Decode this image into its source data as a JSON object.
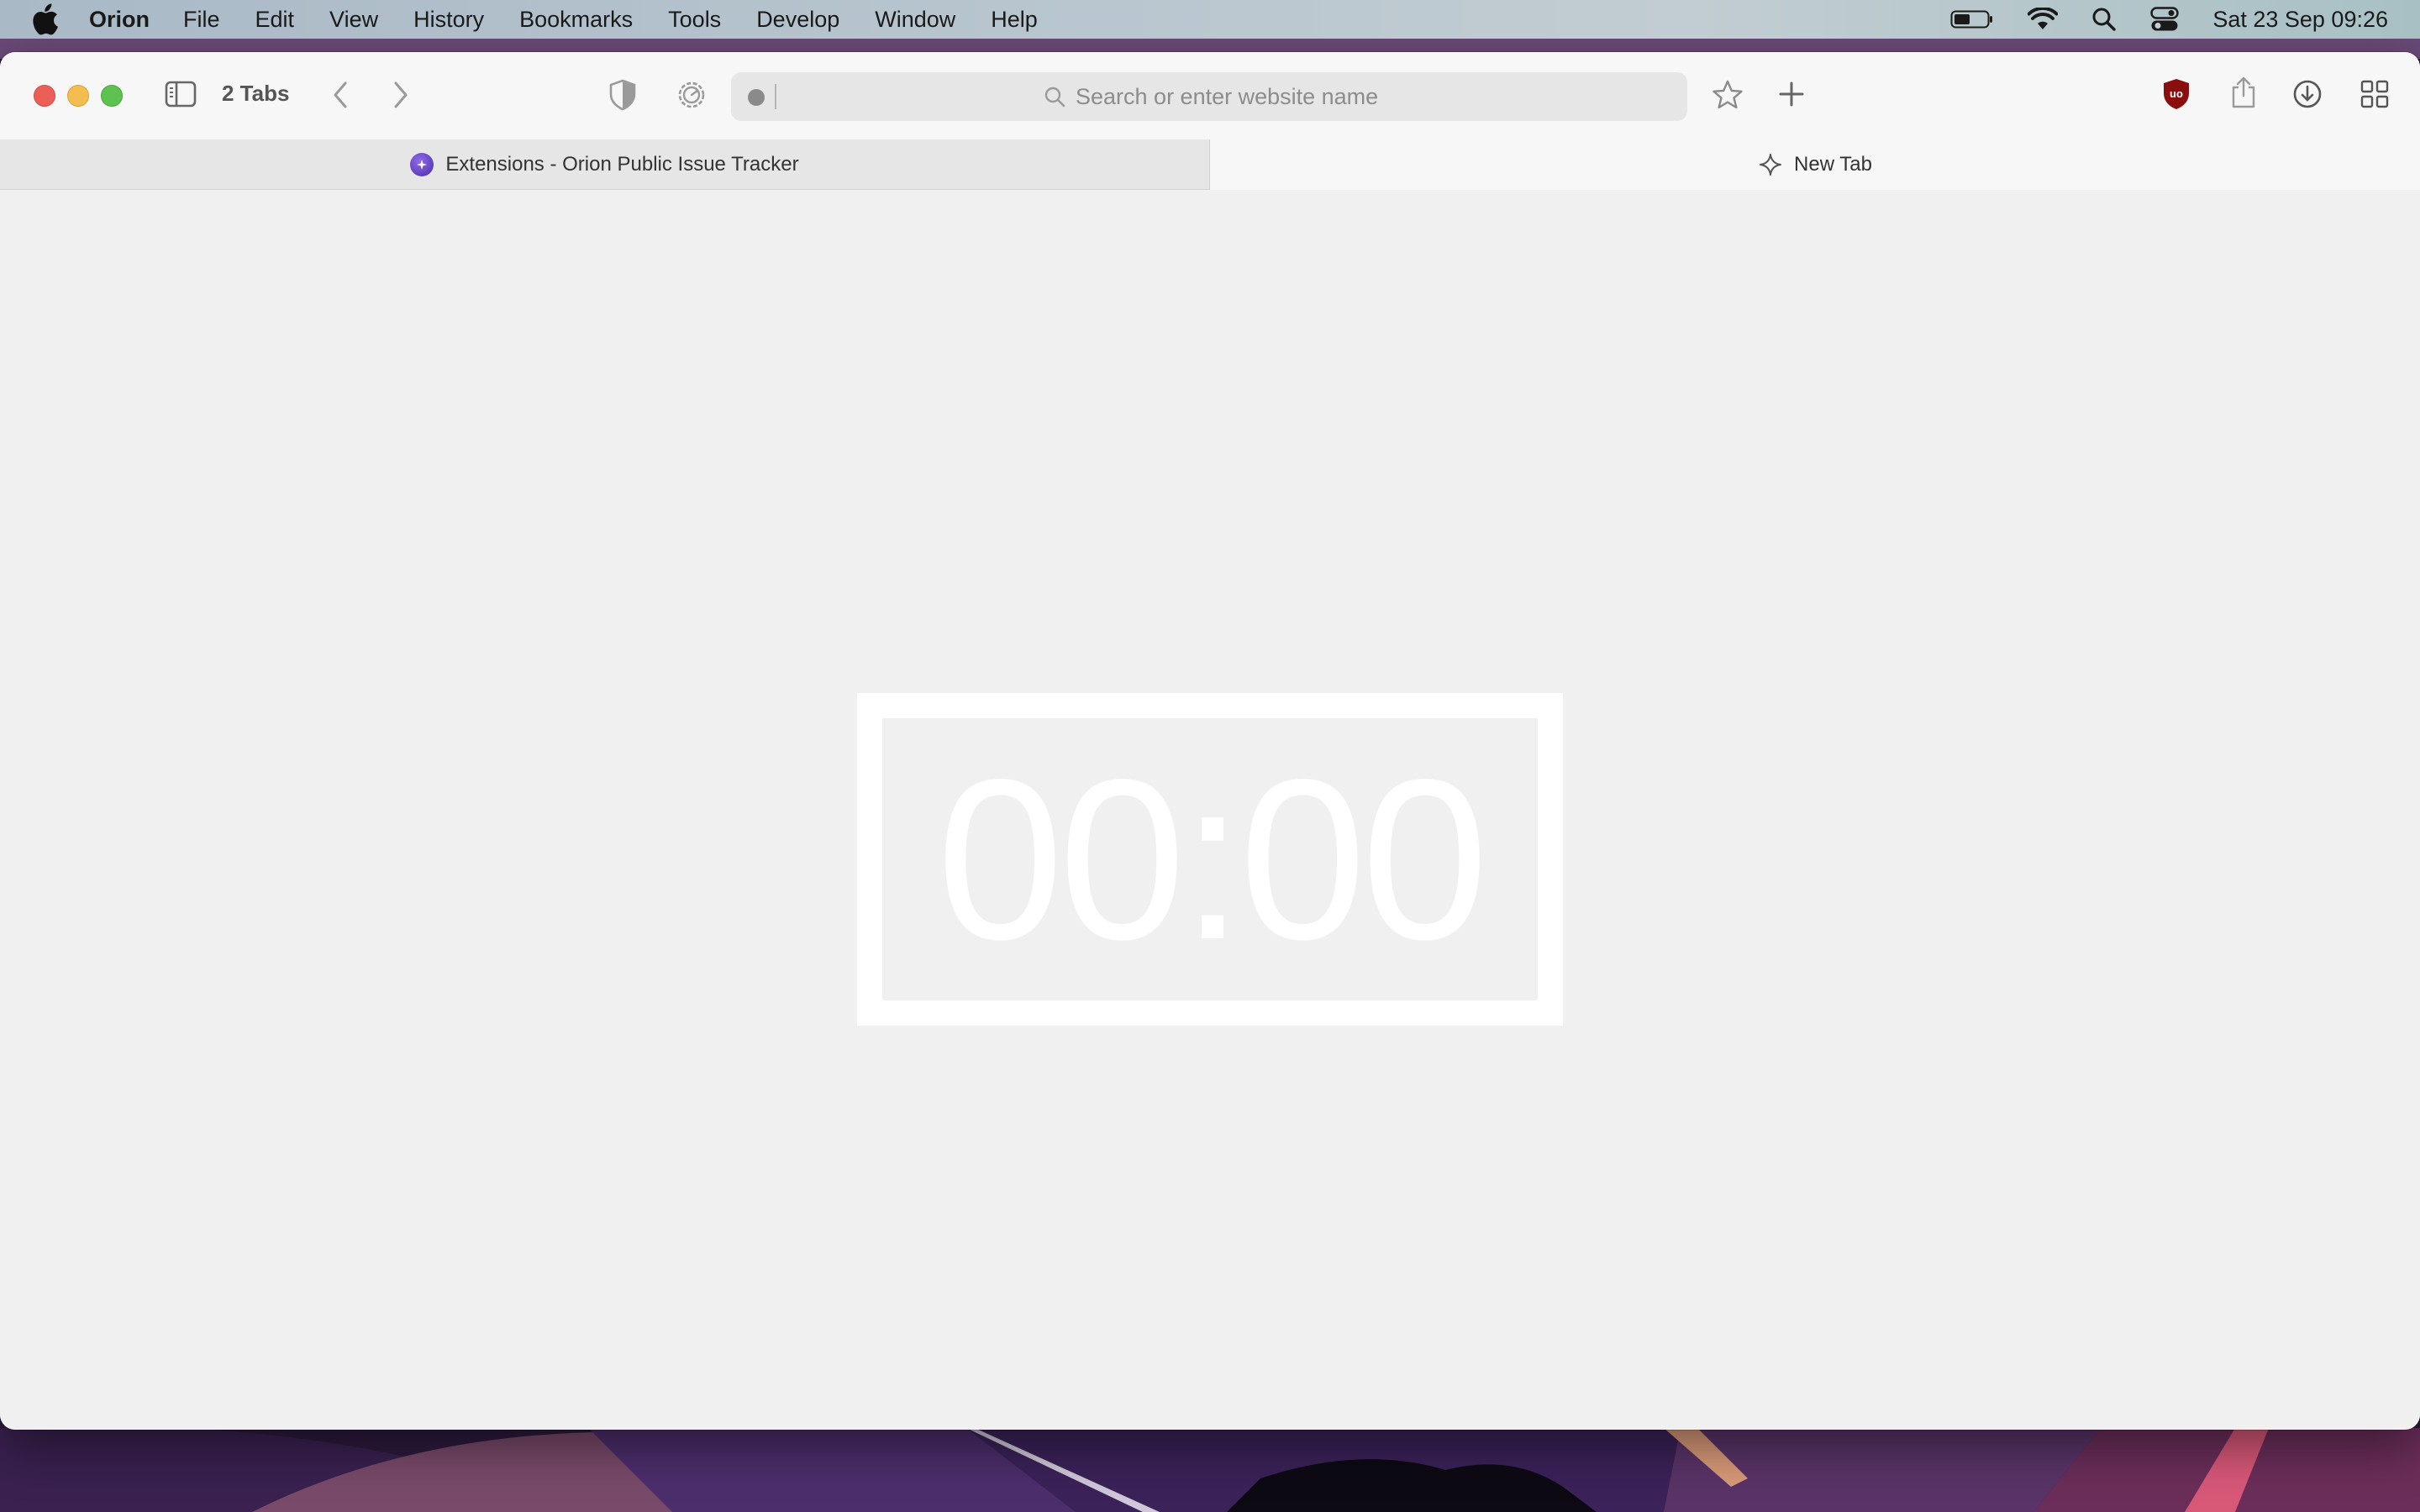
{
  "menubar": {
    "apple_icon": "apple-logo-icon",
    "items": [
      {
        "label": "Orion",
        "app": true
      },
      {
        "label": "File"
      },
      {
        "label": "Edit"
      },
      {
        "label": "View"
      },
      {
        "label": "History"
      },
      {
        "label": "Bookmarks"
      },
      {
        "label": "Tools"
      },
      {
        "label": "Develop"
      },
      {
        "label": "Window"
      },
      {
        "label": "Help"
      }
    ],
    "status_icons": [
      "battery-icon",
      "wifi-icon",
      "spotlight-search-icon",
      "control-center-icon"
    ],
    "clock": "Sat 23 Sep  09:26"
  },
  "toolbar": {
    "tab_count_label": "2 Tabs",
    "address_placeholder": "Search or enter website name",
    "icons": [
      "sidebar-toggle-icon",
      "back-arrow-icon",
      "forward-arrow-icon",
      "shield-icon",
      "settings-gear-icon",
      "bookmark-star-icon",
      "new-tab-plus-icon",
      "ublock-origin-icon",
      "share-icon",
      "downloads-icon",
      "tab-overview-grid-icon"
    ],
    "colors": {
      "ublock_red": "#8b0e0e"
    }
  },
  "tabs": [
    {
      "title": "Extensions - Orion Public Issue Tracker",
      "active": false,
      "favicon": "orion-tracker-favicon"
    },
    {
      "title": "New Tab",
      "active": true,
      "favicon": "sparkle-icon"
    }
  ],
  "content": {
    "timer": "00:00",
    "colors": {
      "background": "#f0f0f0",
      "timer": "#ffffff"
    }
  }
}
